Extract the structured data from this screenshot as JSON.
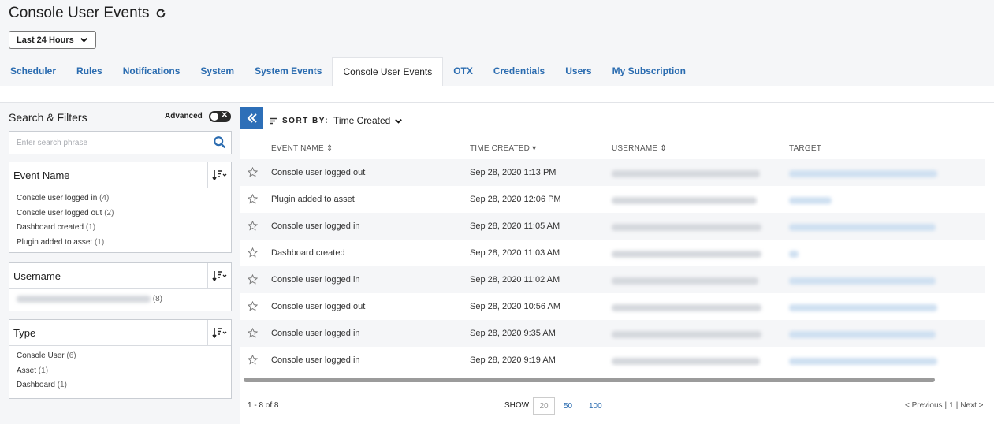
{
  "header": {
    "title": "Console User Events",
    "time_range": "Last 24 Hours"
  },
  "tabs": [
    {
      "label": "Scheduler"
    },
    {
      "label": "Rules"
    },
    {
      "label": "Notifications"
    },
    {
      "label": "System"
    },
    {
      "label": "System Events"
    },
    {
      "label": "Console User Events",
      "active": true
    },
    {
      "label": "OTX"
    },
    {
      "label": "Credentials"
    },
    {
      "label": "Users"
    },
    {
      "label": "My Subscription"
    }
  ],
  "filters": {
    "title": "Search & Filters",
    "advanced_label": "Advanced",
    "advanced_toggle_glyph": "✕",
    "search_placeholder": "Enter search phrase",
    "event_name": {
      "label": "Event Name",
      "items": [
        {
          "label": "Console user logged in",
          "count": "(4)"
        },
        {
          "label": "Console user logged out",
          "count": "(2)"
        },
        {
          "label": "Dashboard created",
          "count": "(1)"
        },
        {
          "label": "Plugin added to asset",
          "count": "(1)"
        }
      ]
    },
    "username": {
      "label": "Username",
      "items": [
        {
          "count": "(8)"
        }
      ]
    },
    "type": {
      "label": "Type",
      "items": [
        {
          "label": "Console User",
          "count": "(6)"
        },
        {
          "label": "Asset",
          "count": "(1)"
        },
        {
          "label": "Dashboard",
          "count": "(1)"
        }
      ]
    }
  },
  "sort": {
    "label": "SORT BY:",
    "value": "Time Created"
  },
  "table": {
    "columns": [
      "EVENT NAME",
      "TIME CREATED",
      "USERNAME",
      "TARGET"
    ],
    "rows": [
      {
        "event": "Console user logged out",
        "time": "Sep 28, 2020 1:13 PM"
      },
      {
        "event": "Plugin added to asset",
        "time": "Sep 28, 2020 12:06 PM"
      },
      {
        "event": "Console user logged in",
        "time": "Sep 28, 2020 11:05 AM"
      },
      {
        "event": "Dashboard created",
        "time": "Sep 28, 2020 11:03 AM"
      },
      {
        "event": "Console user logged in",
        "time": "Sep 28, 2020 11:02 AM"
      },
      {
        "event": "Console user logged out",
        "time": "Sep 28, 2020 10:56 AM"
      },
      {
        "event": "Console user logged in",
        "time": "Sep 28, 2020 9:35 AM"
      },
      {
        "event": "Console user logged in",
        "time": "Sep 28, 2020 9:19 AM"
      }
    ]
  },
  "footer": {
    "count": "1 - 8 of 8",
    "show_label": "SHOW",
    "page_sizes": [
      "20",
      "50",
      "100"
    ],
    "prev": "< Previous",
    "sep1": "|",
    "page": "1",
    "sep2": "|",
    "next": "Next >"
  }
}
